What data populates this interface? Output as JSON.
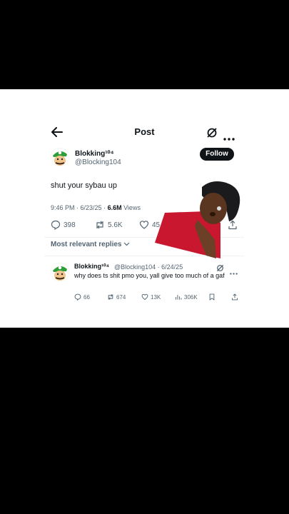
{
  "header": {
    "title": "Post"
  },
  "post": {
    "display_name": "Blokking¹⁰⁴",
    "handle": "@Blocking104",
    "follow_label": "Follow",
    "text": "shut your sybau up",
    "time": "9:46 PM · 6/23/25 ·",
    "views_count": "6.6M",
    "views_label": "Views",
    "replies": "398",
    "reposts": "5.6K",
    "likes": "45"
  },
  "sort": {
    "label": "Most relevant replies"
  },
  "reply": {
    "display_name": "Blokking¹⁰⁴",
    "handle_date": "@Blocking104 · 6/24/25",
    "text": "why does ts shit pmo you, yall give too much of a gaf",
    "replies": "66",
    "reposts": "674",
    "likes": "13K",
    "views": "306K"
  },
  "colors": {
    "follow_bg": "#0f1419",
    "secondary": "#536471",
    "avatar_green": "#7cc043"
  }
}
